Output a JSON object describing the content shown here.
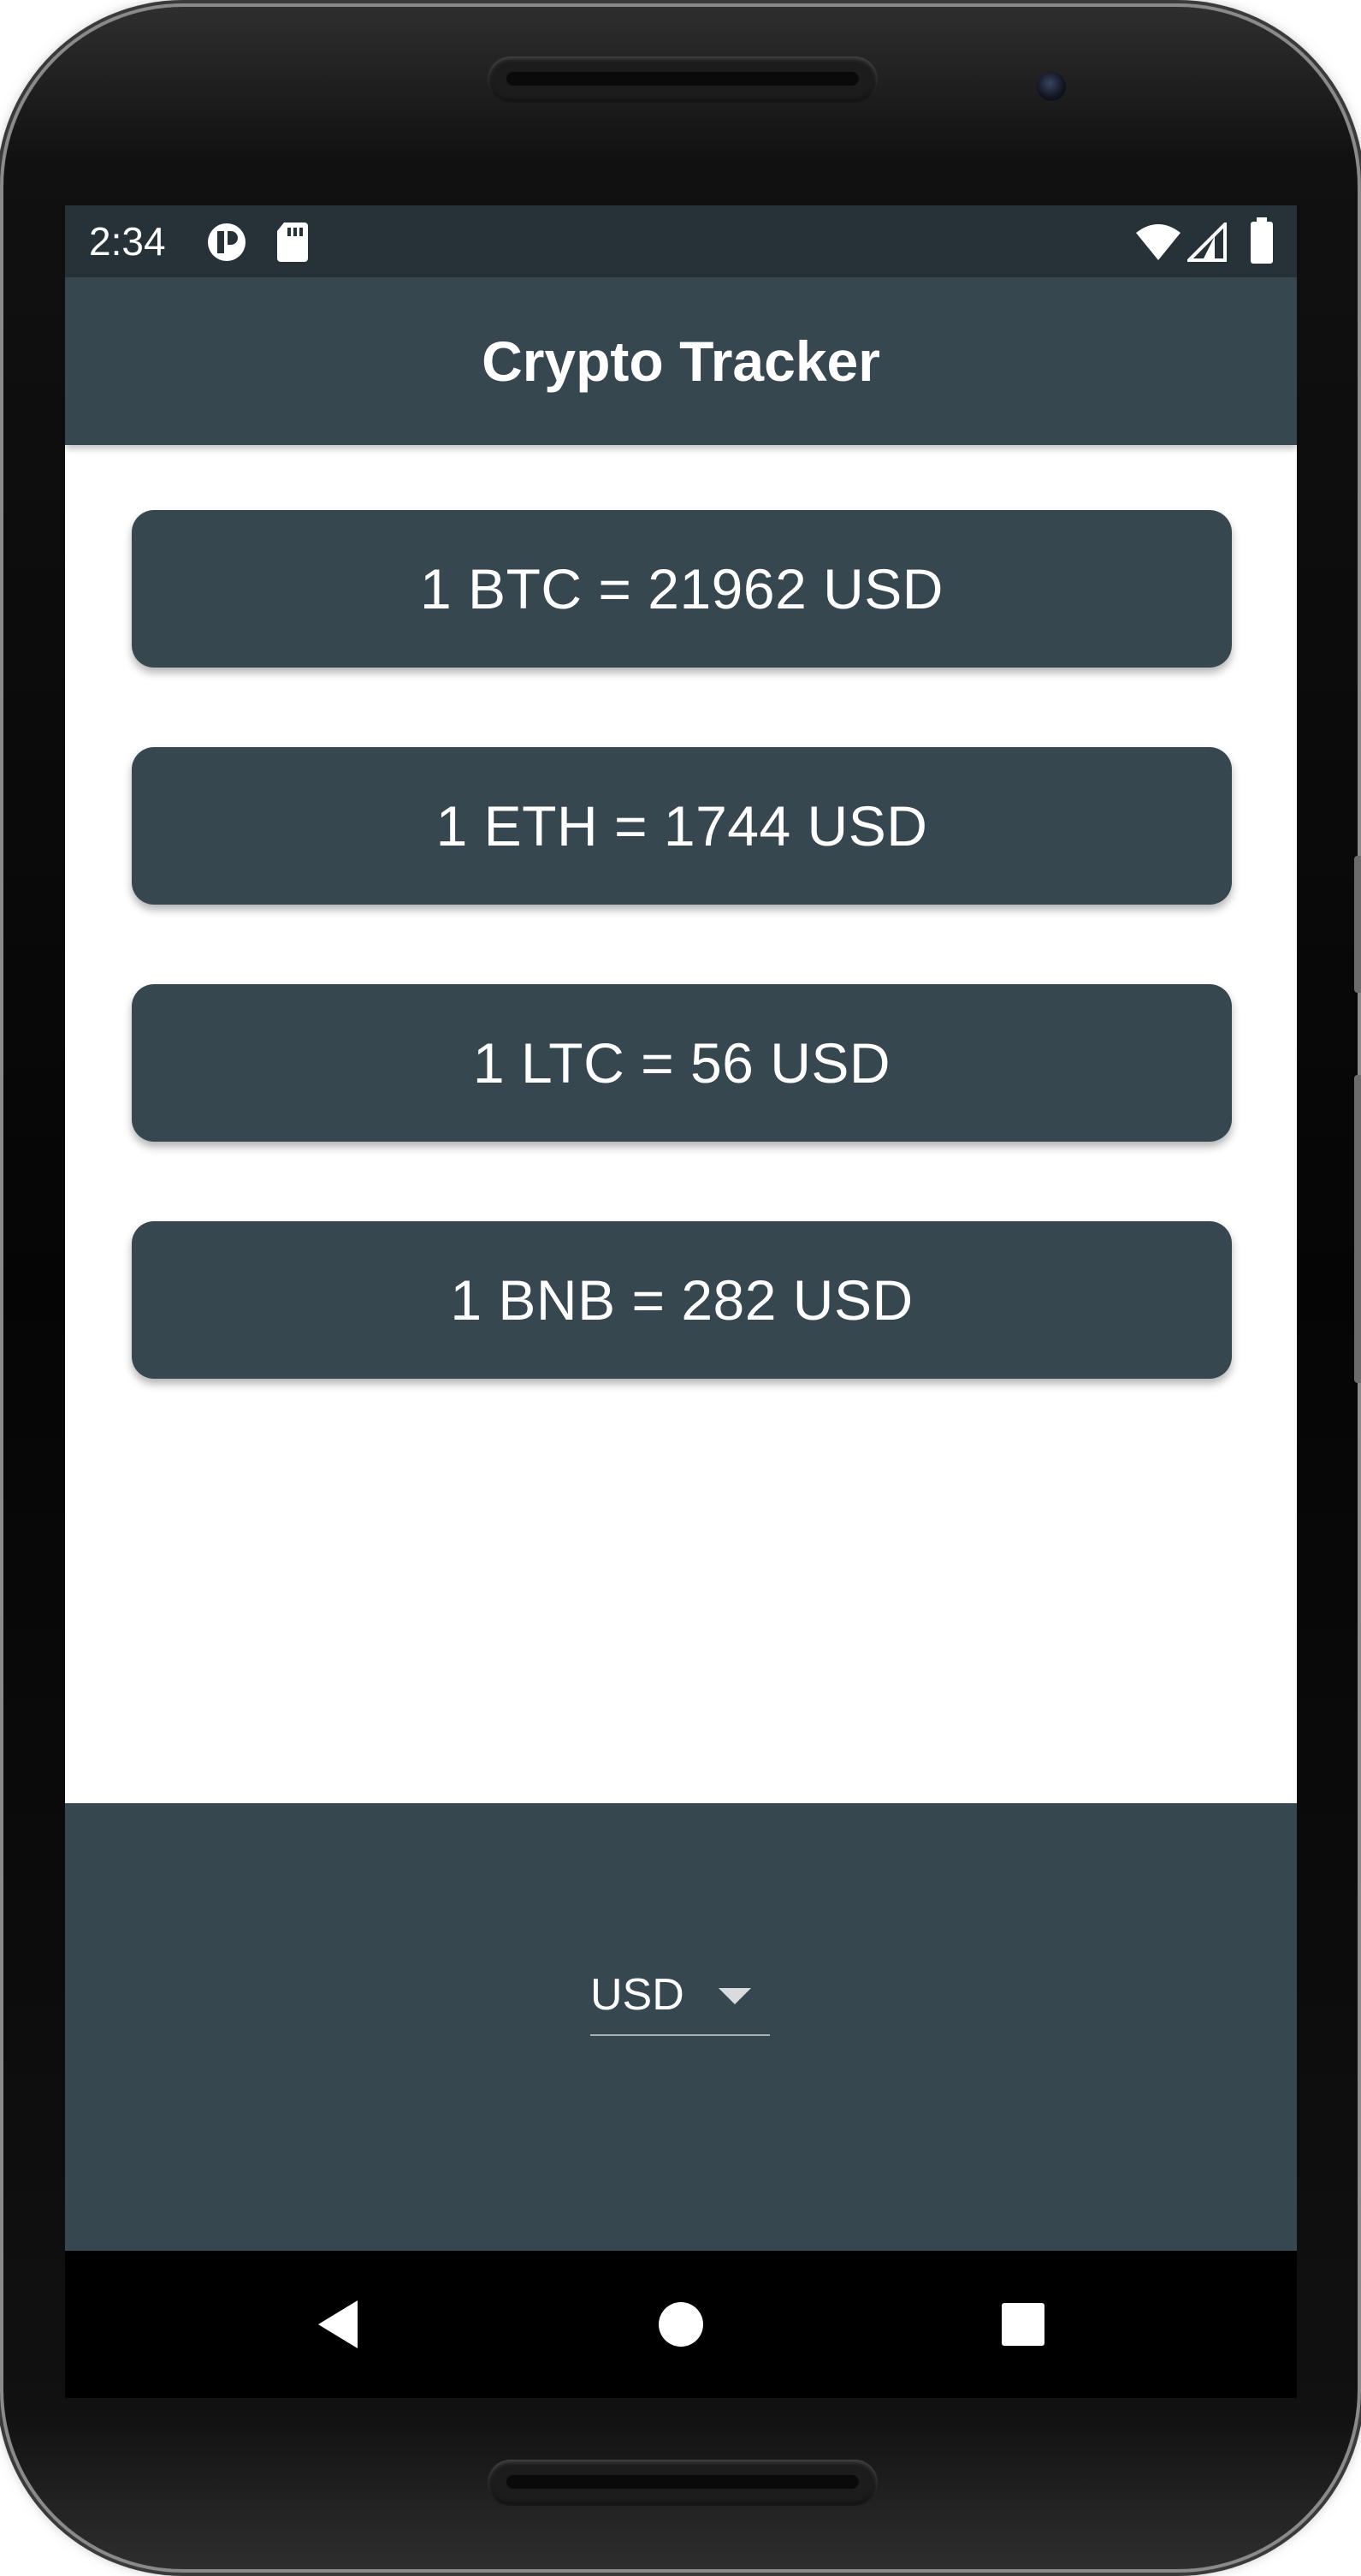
{
  "status_bar": {
    "time": "2:34",
    "icons": [
      "app-notification-icon",
      "sd-card-icon",
      "wifi-icon",
      "cell-signal-icon",
      "battery-icon"
    ]
  },
  "app_bar": {
    "title": "Crypto Tracker"
  },
  "rates": [
    {
      "text": "1 BTC = 21962 USD"
    },
    {
      "text": "1 ETH = 1744 USD"
    },
    {
      "text": "1 LTC = 56 USD"
    },
    {
      "text": "1 BNB = 282 USD"
    }
  ],
  "currency_selector": {
    "selected": "USD"
  },
  "nav_bar": {
    "icons": [
      "back-icon",
      "home-icon",
      "recents-icon"
    ]
  },
  "colors": {
    "primary": "#37474f",
    "status_bar": "#263238",
    "text_on_primary": "#ffffff"
  }
}
